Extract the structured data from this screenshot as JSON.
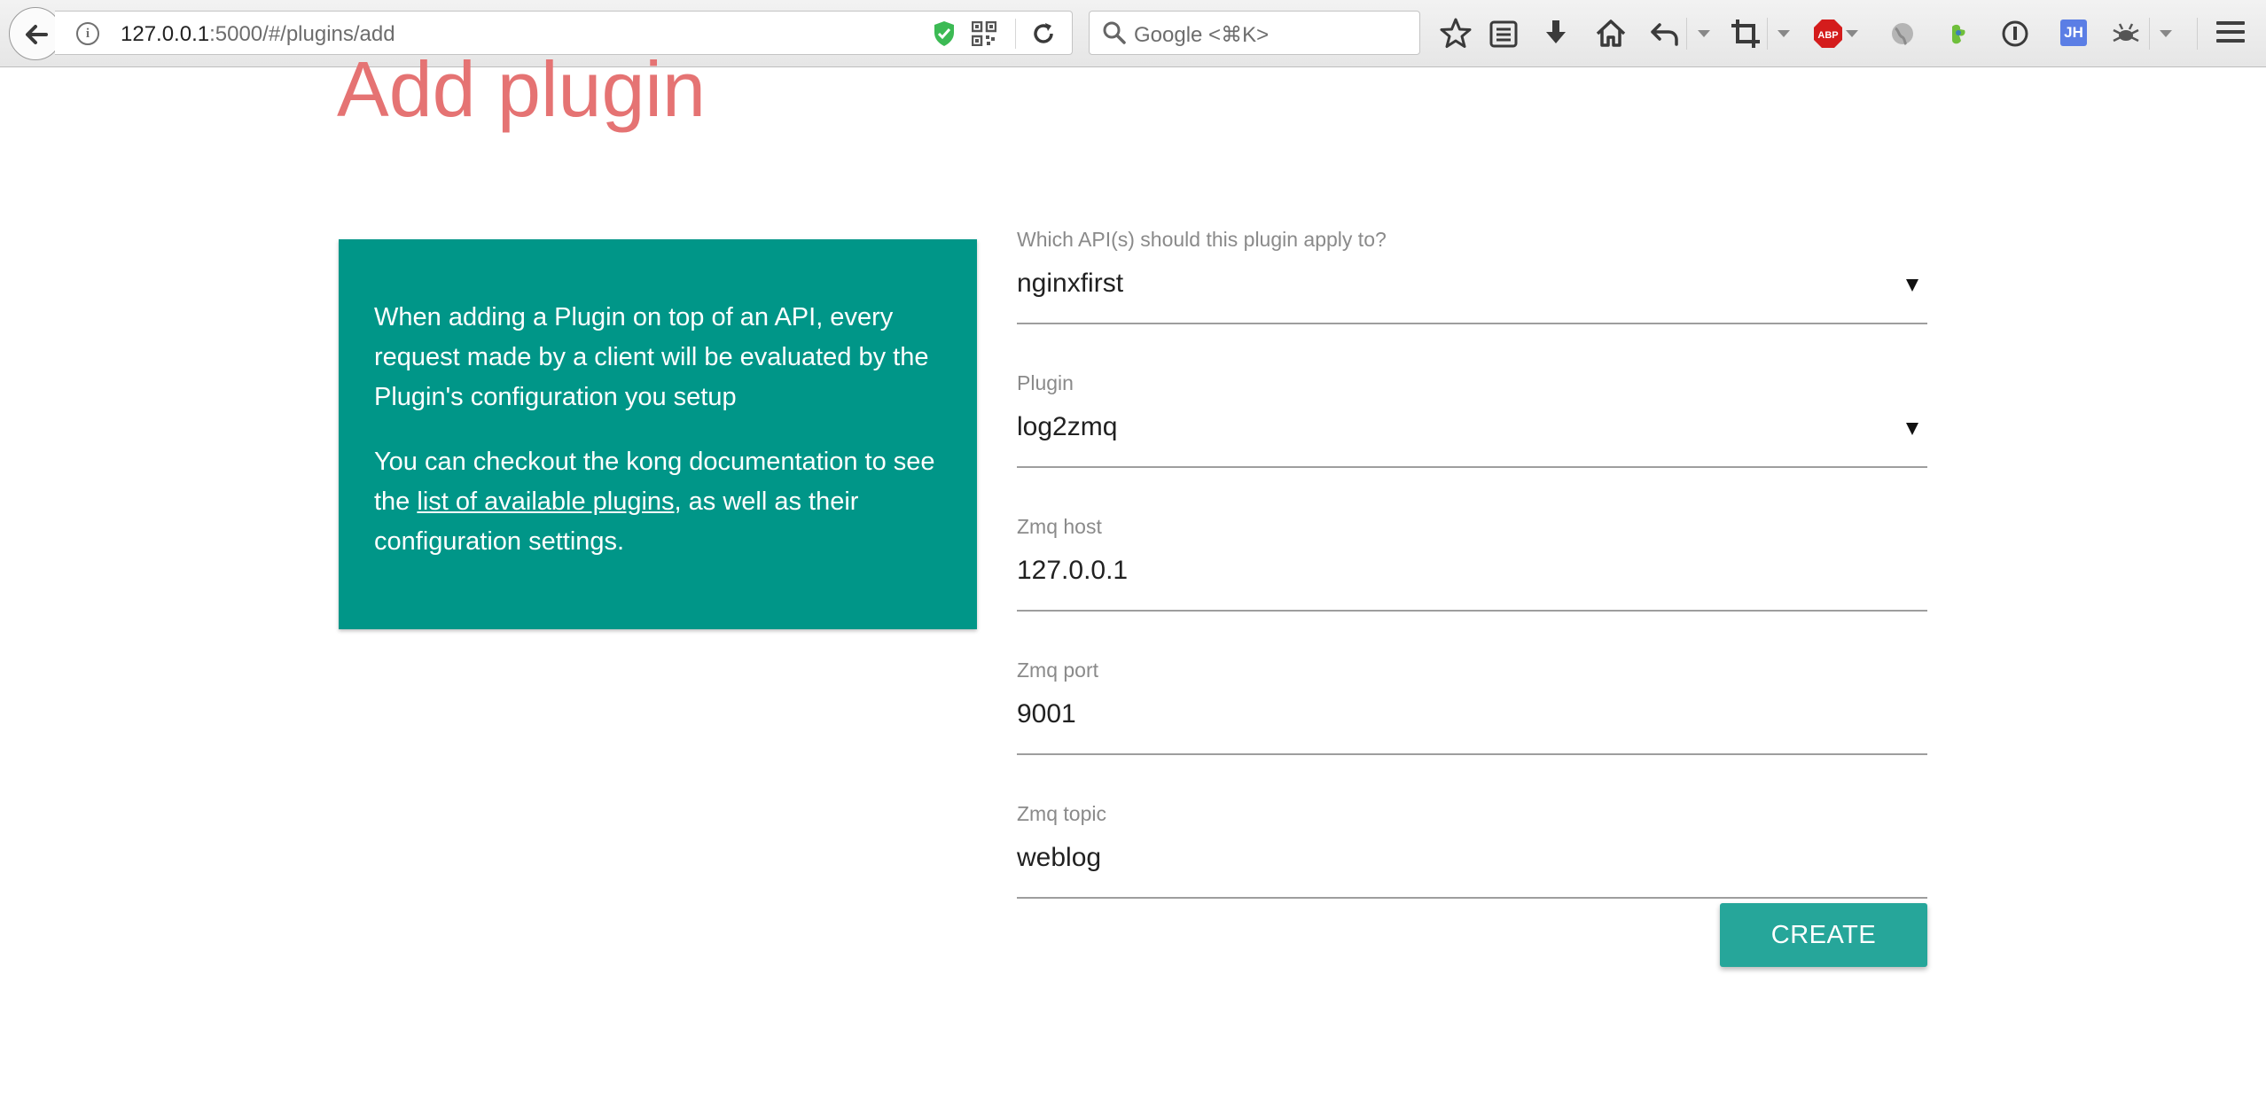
{
  "browser": {
    "url_host": "127.0.0.1",
    "url_rest": ":5000/#/plugins/add",
    "search_placeholder": "Google <⌘K>",
    "abp_label": "ABP",
    "jh_label": "JH"
  },
  "page": {
    "title": "Add plugin",
    "info_card": {
      "paragraph1": "When adding a Plugin on top of an API, every request made by a client will be evaluated by the Plugin's configuration you setup",
      "paragraph2_before": "You can checkout the kong documentation to see the ",
      "paragraph2_link": "list of available plugins",
      "paragraph2_after": ", as well as their configuration settings."
    },
    "form": {
      "api": {
        "label": "Which API(s) should this plugin apply to?",
        "value": "nginxfirst"
      },
      "plugin": {
        "label": "Plugin",
        "value": "log2zmq"
      },
      "zmq_host": {
        "label": "Zmq host",
        "value": "127.0.0.1"
      },
      "zmq_port": {
        "label": "Zmq port",
        "value": "9001"
      },
      "zmq_topic": {
        "label": "Zmq topic",
        "value": "weblog"
      }
    },
    "create_label": "CREATE"
  },
  "colors": {
    "title": "#e57373",
    "card": "#009688",
    "button": "#26a69a"
  }
}
